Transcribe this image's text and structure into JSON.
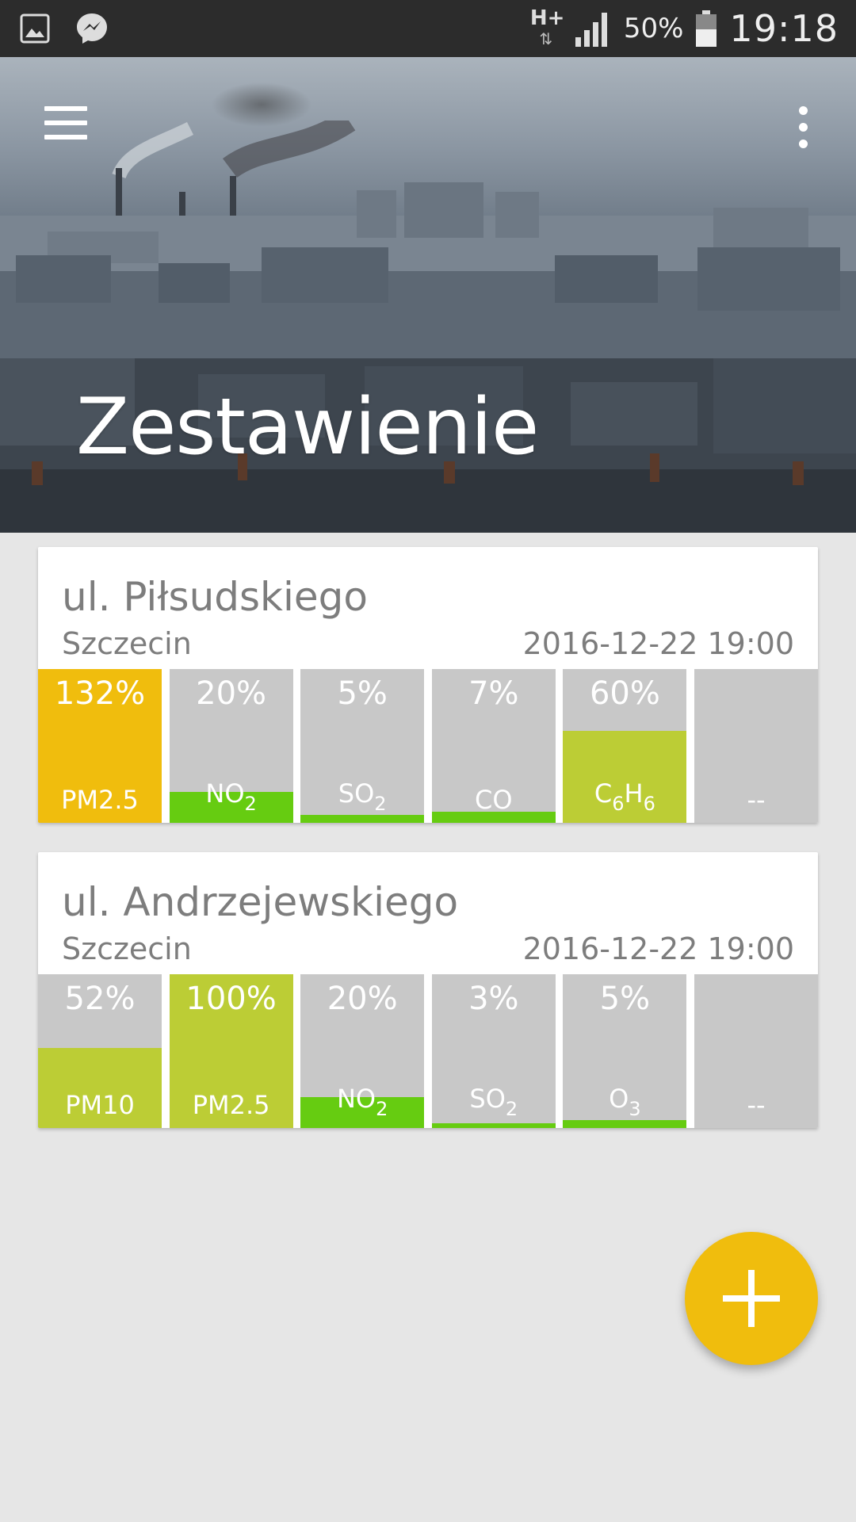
{
  "status_bar": {
    "network_type": "H+",
    "battery_percent": "50%",
    "time": "19:18",
    "left_icons": [
      "gallery-icon",
      "messenger-icon"
    ],
    "right_icons": [
      "network-arrows-icon",
      "signal-icon",
      "battery-icon"
    ]
  },
  "header": {
    "title": "Zestawienie",
    "menu_icon": "hamburger-menu-icon",
    "more_icon": "more-vert-icon"
  },
  "colors": {
    "accent": "#f0bd0d",
    "status_green": "#66cc11",
    "status_lime": "#bccd35",
    "status_orange": "#f0bd0d",
    "tile_gray": "#c8c8c8",
    "background": "#e6e6e6"
  },
  "stations": [
    {
      "name": "ul. Piłsudskiego",
      "city": "Szczecin",
      "datetime": "2016-12-22 19:00",
      "pollutants": [
        {
          "percent_label": "132%",
          "value": 132,
          "name": "PM2.5",
          "sub": "",
          "name2": "",
          "sub2": "",
          "color": "#f0bd0d"
        },
        {
          "percent_label": "20%",
          "value": 20,
          "name": "NO",
          "sub": "2",
          "name2": "",
          "sub2": "",
          "color": "#66cc11"
        },
        {
          "percent_label": "5%",
          "value": 5,
          "name": "SO",
          "sub": "2",
          "name2": "",
          "sub2": "",
          "color": "#66cc11"
        },
        {
          "percent_label": "7%",
          "value": 7,
          "name": "CO",
          "sub": "",
          "name2": "",
          "sub2": "",
          "color": "#66cc11"
        },
        {
          "percent_label": "60%",
          "value": 60,
          "name": "C",
          "sub": "6",
          "name2": "H",
          "sub2": "6",
          "color": "#bccd35"
        },
        {
          "percent_label": "",
          "value": 0,
          "name": "--",
          "sub": "",
          "name2": "",
          "sub2": "",
          "color": "#66cc11"
        }
      ]
    },
    {
      "name": "ul. Andrzejewskiego",
      "city": "Szczecin",
      "datetime": "2016-12-22 19:00",
      "pollutants": [
        {
          "percent_label": "52%",
          "value": 52,
          "name": "PM10",
          "sub": "",
          "name2": "",
          "sub2": "",
          "color": "#bccd35"
        },
        {
          "percent_label": "100%",
          "value": 100,
          "name": "PM2.5",
          "sub": "",
          "name2": "",
          "sub2": "",
          "color": "#bccd35"
        },
        {
          "percent_label": "20%",
          "value": 20,
          "name": "NO",
          "sub": "2",
          "name2": "",
          "sub2": "",
          "color": "#66cc11"
        },
        {
          "percent_label": "3%",
          "value": 3,
          "name": "SO",
          "sub": "2",
          "name2": "",
          "sub2": "",
          "color": "#66cc11"
        },
        {
          "percent_label": "5%",
          "value": 5,
          "name": "O",
          "sub": "3",
          "name2": "",
          "sub2": "",
          "color": "#66cc11"
        },
        {
          "percent_label": "",
          "value": 0,
          "name": "--",
          "sub": "",
          "name2": "",
          "sub2": "",
          "color": "#66cc11"
        }
      ]
    }
  ],
  "fab": {
    "icon": "plus-icon"
  }
}
